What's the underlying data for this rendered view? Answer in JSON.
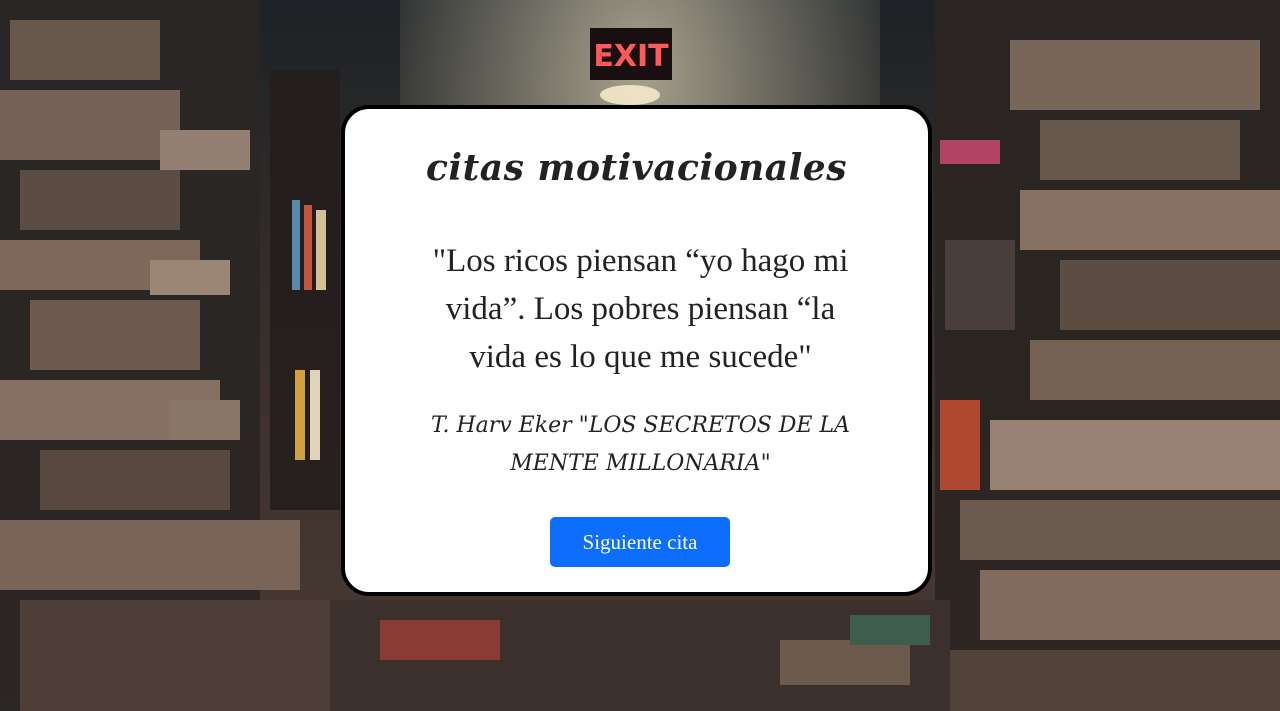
{
  "background": {
    "image": "library-bookshelves-photo",
    "exit_sign_text": "EXIT"
  },
  "card": {
    "title": "citas motivacionales",
    "quote": "\"Los ricos piensan “yo hago mi vida”. Los pobres piensan “la vida es lo que me sucede\"",
    "author": "T. Harv Eker \"LOS SECRETOS DE LA MENTE MILLONARIA\"",
    "next_button_label": "Siguiente cita"
  },
  "colors": {
    "accent": "#0d6efd",
    "card_background": "#ffffff",
    "card_border": "#000000",
    "text": "#222222"
  }
}
